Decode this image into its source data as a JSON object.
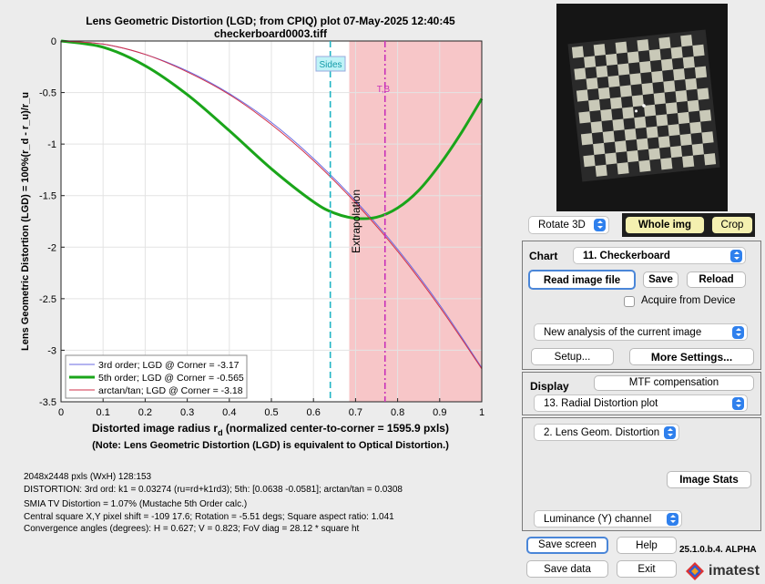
{
  "plot": {
    "title_line1": "Lens Geometric Distortion (LGD; from CPIQ) plot   07-May-2025 12:40:45",
    "title_line2": "checkerboard0003.tiff",
    "xlabel_main": "Distorted image radius r",
    "xlabel_sub": "d",
    "xlabel_tail": "  (normalized center-to-corner = 1595.9 pxls)",
    "note": "(Note: Lens Geometric Distortion (LGD) is equivalent to Optical Distortion.)",
    "ylabel": "Lens Geometric Distortion (LGD) = 100%(r_d - r_u)/r_u",
    "marker_sides": "Sides",
    "marker_tb": "T,B",
    "extrapolation": "Extrapolation",
    "legend": [
      {
        "label": "3rd order;   LGD @ Corner = -3.17",
        "color": "#6a6ae0",
        "width": 1
      },
      {
        "label": "5th order;   LGD @ Corner = -0.565",
        "color": "#1aa51a",
        "width": 3
      },
      {
        "label": "arctan/tan; LGD @ Corner = -3.18",
        "color": "#d0304a",
        "width": 1
      }
    ]
  },
  "chart_data": {
    "type": "line",
    "x_ticks": [
      "0",
      "0.1",
      "0.2",
      "0.3",
      "0.4",
      "0.5",
      "0.6",
      "0.7",
      "0.8",
      "0.9",
      "1"
    ],
    "y_ticks": [
      "0",
      "-0.5",
      "-1",
      "-1.5",
      "-2",
      "-2.5",
      "-3",
      "-3.5"
    ],
    "xlim": [
      0,
      1
    ],
    "ylim": [
      -3.5,
      0
    ],
    "sides_x": 0.64,
    "tb_x": 0.77,
    "extrapolation_from_x": 0.685,
    "series": [
      {
        "name": "3rd order",
        "x": [
          0,
          0.1,
          0.2,
          0.3,
          0.4,
          0.5,
          0.6,
          0.7,
          0.8,
          0.9,
          1.0
        ],
        "y": [
          0,
          -0.03,
          -0.13,
          -0.29,
          -0.51,
          -0.79,
          -1.14,
          -1.55,
          -2.02,
          -2.56,
          -3.17
        ]
      },
      {
        "name": "5th order",
        "x": [
          0,
          0.1,
          0.2,
          0.3,
          0.4,
          0.5,
          0.6,
          0.65,
          0.7,
          0.75,
          0.8,
          0.85,
          0.9,
          0.95,
          1.0
        ],
        "y": [
          0,
          -0.06,
          -0.24,
          -0.52,
          -0.87,
          -1.24,
          -1.56,
          -1.67,
          -1.72,
          -1.71,
          -1.62,
          -1.45,
          -1.2,
          -0.9,
          -0.56
        ]
      },
      {
        "name": "arctan/tan",
        "x": [
          0,
          0.1,
          0.2,
          0.3,
          0.4,
          0.5,
          0.6,
          0.7,
          0.8,
          0.9,
          1.0
        ],
        "y": [
          0,
          -0.03,
          -0.13,
          -0.3,
          -0.52,
          -0.81,
          -1.16,
          -1.57,
          -2.04,
          -2.58,
          -3.18
        ]
      }
    ]
  },
  "info": {
    "line1": "2048x2448 pxls (WxH) 128:153",
    "line2": "DISTORTION:  3rd ord:  k1 = 0.03274  (ru=rd+k1rd3);   5th: [0.0638  -0.0581];   arctan/tan = 0.0308",
    "line3": "SMIA TV Distortion = 1.07%  (Mustache   5th Order calc.)",
    "line4": "Central square X,Y pixel shift = -109  17.6;   Rotation = -5.51 degs;   Square aspect ratio: 1.041",
    "line5": "Convergence angles (degrees):  H = 0.627;  V = 0.823;   FoV diag = 28.12 * square ht"
  },
  "controls": {
    "rotate": "Rotate 3D",
    "whole_img": "Whole img",
    "crop": "Crop",
    "chart_label": "Chart",
    "chart_select": "11. Checkerboard",
    "read_image": "Read image file",
    "save": "Save",
    "reload": "Reload",
    "acquire": "Acquire from Device",
    "analysis_select": "New analysis of the current image",
    "setup": "Setup...",
    "more_settings": "More Settings...",
    "display_label": "Display",
    "mtf_comp": "MTF compensation",
    "display_select": "13. Radial Distortion plot",
    "lgd_select": "2. Lens Geom. Distortion",
    "image_stats": "Image Stats",
    "channel_select": "Luminance (Y) channel",
    "save_screen": "Save screen",
    "help": "Help",
    "save_data": "Save data",
    "exit": "Exit",
    "version": "25.1.0.b.4. ALPHA",
    "logo": "imatest"
  },
  "colors": {
    "accent": "#2f80ed",
    "highlight": "#f4f0b0",
    "extrap_fill": "#f7c6c8",
    "sides_line": "#20b5c5",
    "tb_line": "#c832b8"
  }
}
